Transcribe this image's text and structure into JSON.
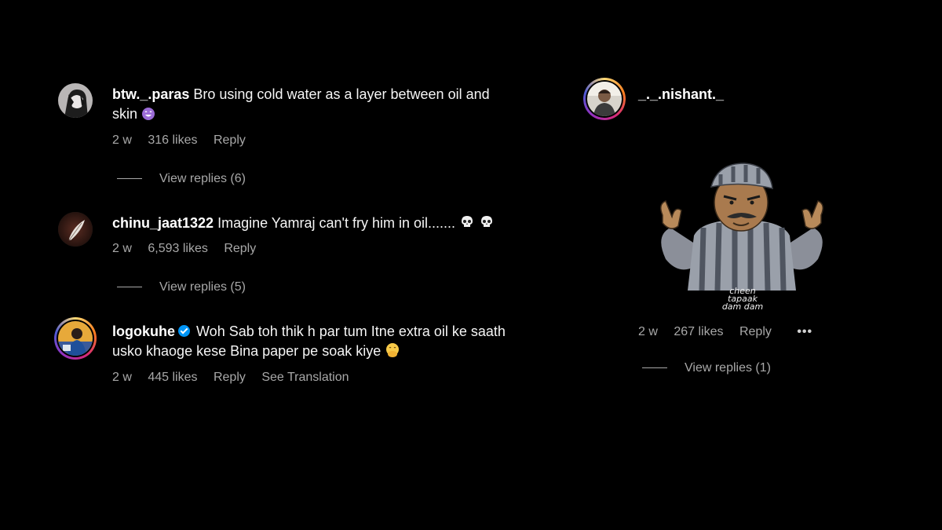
{
  "comments": [
    {
      "username": "btw._.paras",
      "text_line1": "Bro using cold water as a layer between oil and",
      "text_line2": "skin",
      "emoji": "crying-laughing-purple-emoji",
      "age": "2 w",
      "likes": "316 likes",
      "reply_label": "Reply",
      "view_replies": "View replies (6)"
    },
    {
      "username": "chinu_jaat1322",
      "text": "Imagine Yamraj can't fry him in oil.......",
      "emoji": "skull-emoji",
      "age": "2 w",
      "likes": "6,593 likes",
      "reply_label": "Reply",
      "view_replies": "View replies (5)"
    },
    {
      "username": "logokuhe",
      "verified": true,
      "text_line1": "Woh Sab toh thik h par tum Itne extra oil ke saath",
      "text_line2": "usko khaoge kese Bina paper pe soak kiye",
      "emoji": "face-with-hand-over-mouth-emoji",
      "age": "2 w",
      "likes": "445 likes",
      "reply_label": "Reply",
      "translation_label": "See Translation"
    },
    {
      "username": "_._.nishant._",
      "sticker": "cartoon-prisoner-sticker",
      "sticker_text_line1": "cheen",
      "sticker_text_line2": "tapaak",
      "sticker_text_line3": "dam dam",
      "age": "2 w",
      "likes": "267 likes",
      "reply_label": "Reply",
      "more_label": "•••",
      "view_replies": "View replies (1)"
    }
  ],
  "colors": {
    "background": "#000000",
    "text": "#f5f5f5",
    "muted": "#a8a8a8",
    "verified": "#0095f6"
  }
}
